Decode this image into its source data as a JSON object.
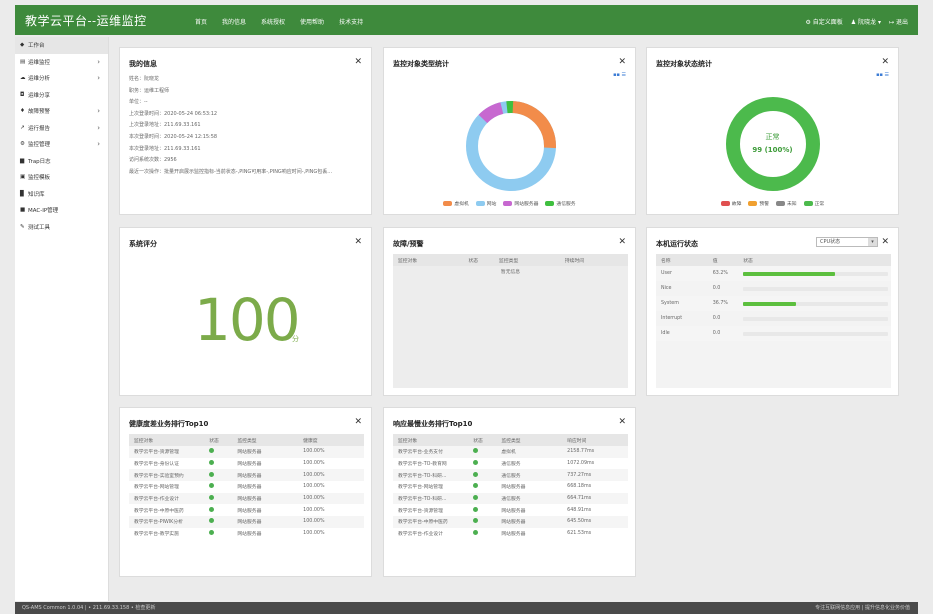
{
  "app": {
    "title": "教学云平台--运维监控",
    "nav": [
      "首页",
      "我的信息",
      "系统授权",
      "使用帮助",
      "技术支持"
    ],
    "tools": {
      "custom_panel": "自定义面板",
      "user": "阮晓龙",
      "logout": "退出"
    }
  },
  "sidebar": {
    "items": [
      {
        "icon": "home-icon",
        "glyph": "◆",
        "label": "工作台",
        "active": true,
        "chevron": false
      },
      {
        "icon": "monitor-icon",
        "glyph": "▤",
        "label": "运维监控",
        "chevron": true
      },
      {
        "icon": "cloud-icon",
        "glyph": "☁",
        "label": "运维分析",
        "chevron": true
      },
      {
        "icon": "share-icon",
        "glyph": "◘",
        "label": "运维分享",
        "chevron": false
      },
      {
        "icon": "bell-icon",
        "glyph": "♦",
        "label": "故障预警",
        "chevron": true
      },
      {
        "icon": "chart-icon",
        "glyph": "↗",
        "label": "运行报告",
        "chevron": true
      },
      {
        "icon": "gear-icon",
        "glyph": "⚙",
        "label": "监控管理",
        "chevron": true
      },
      {
        "icon": "file-icon",
        "glyph": "▆",
        "label": "Trap日志",
        "chevron": false
      },
      {
        "icon": "template-icon",
        "glyph": "▣",
        "label": "监控模板",
        "chevron": false
      },
      {
        "icon": "book-icon",
        "glyph": "▉",
        "label": "知识库",
        "chevron": false
      },
      {
        "icon": "bookmark-icon",
        "glyph": "■",
        "label": "MAC-IP管理",
        "chevron": false
      },
      {
        "icon": "wrench-icon",
        "glyph": "✎",
        "label": "测试工具",
        "chevron": false
      }
    ]
  },
  "my_info": {
    "title": "我的信息",
    "lines": [
      "姓名：阮晓龙",
      "职务：运维工程师",
      "单位：--",
      "上次登录时间：2020-05-24 06:53:12",
      "上次登录地址：211.69.33.161",
      "本次登录时间：2020-05-24 12:15:58",
      "本次登录地址：211.69.33.161",
      "访问系统次数：2956",
      "最近一次操作：批量开启展示监控指标-当前状态-,PING可用率-,PING响应时间-,PING包丢..."
    ]
  },
  "type_stats": {
    "title": "监控对象类型统计",
    "legend": [
      {
        "label": "虚拟机",
        "color": "#f28c4a"
      },
      {
        "label": "网站",
        "color": "#8ecbf0"
      },
      {
        "label": "网站服务器",
        "color": "#c768d0"
      },
      {
        "label": "通信服务",
        "color": "#3fbf3f"
      }
    ]
  },
  "status_stats": {
    "title": "监控对象状态统计",
    "center_label": "正常",
    "center_value": "99 (100%)",
    "legend": [
      {
        "label": "故障",
        "color": "#e05050"
      },
      {
        "label": "预警",
        "color": "#f0a030"
      },
      {
        "label": "未知",
        "color": "#888888"
      },
      {
        "label": "正常",
        "color": "#4cba4c"
      }
    ]
  },
  "score": {
    "title": "系统评分",
    "value": "100",
    "unit": "分"
  },
  "faults": {
    "title": "故障/预警",
    "columns": [
      "监控对象",
      "状态",
      "监控类型",
      "持续时间"
    ],
    "empty": "暂无信息"
  },
  "runtime": {
    "title": "本机运行状态",
    "selector": "CPU状态",
    "columns": [
      "名称",
      "值",
      "状态"
    ],
    "rows": [
      {
        "name": "User",
        "value": "63.2%",
        "pct": 0.632
      },
      {
        "name": "Nice",
        "value": "0.0",
        "pct": 0
      },
      {
        "name": "System",
        "value": "36.7%",
        "pct": 0.367
      },
      {
        "name": "Interrupt",
        "value": "0.0",
        "pct": 0
      },
      {
        "name": "Idle",
        "value": "0.0",
        "pct": 0
      }
    ]
  },
  "health_top": {
    "title": "健康度差业务排行Top10",
    "columns": [
      "监控对象",
      "状态",
      "监控类型",
      "健康度"
    ],
    "rows": [
      [
        "教学云平台-资源管理",
        "网站服务器",
        "100.00%"
      ],
      [
        "教学云平台-身份认证",
        "网站服务器",
        "100.00%"
      ],
      [
        "教学云平台-实验室预约",
        "网站服务器",
        "100.00%"
      ],
      [
        "教学云平台-网站管理",
        "网站服务器",
        "100.00%"
      ],
      [
        "教学云平台-作业设计",
        "网站服务器",
        "100.00%"
      ],
      [
        "教学云平台-中原中医药",
        "网站服务器",
        "100.00%"
      ],
      [
        "教学云平台-PIWIK分析",
        "网站服务器",
        "100.00%"
      ],
      [
        "教学云平台-教学实施",
        "网站服务器",
        "100.00%"
      ]
    ]
  },
  "resp_top": {
    "title": "响应最慢业务排行Top10",
    "columns": [
      "监控对象",
      "状态",
      "监控类型",
      "响应时间"
    ],
    "rows": [
      [
        "教学云平台-业务支付",
        "虚拟机",
        "2158.77ms"
      ],
      [
        "教学云平台-TO-教育网",
        "通信服务",
        "1072.09ms"
      ],
      [
        "教学云平台-TO-科研...",
        "通信服务",
        "737.27ms"
      ],
      [
        "教学云平台-网站管理",
        "网站服务器",
        "668.18ms"
      ],
      [
        "教学云平台-TO-科研...",
        "通信服务",
        "664.71ms"
      ],
      [
        "教学云平台-资源管理",
        "网站服务器",
        "648.91ms"
      ],
      [
        "教学云平台-中原中医药",
        "网站服务器",
        "645.50ms"
      ],
      [
        "教学云平台-作业设计",
        "网站服务器",
        "621.53ms"
      ]
    ]
  },
  "footer": {
    "left": "QS-AMS Common 1.0.04 | • 211.69.33.158 • 检查更新",
    "right": "专注互联网信息应用 | 提升信息化业务价值"
  }
}
